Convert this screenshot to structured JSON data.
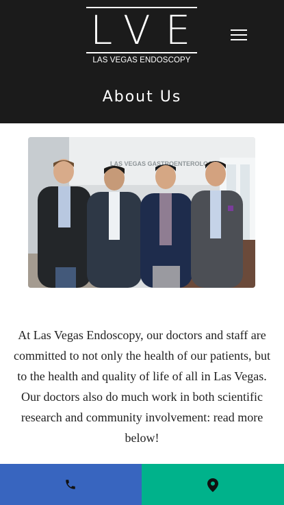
{
  "header": {
    "logo_letters": "LVE",
    "logo_subtitle": "LAS VEGAS ENDOSCOPY",
    "menu_icon": "hamburger-menu-icon",
    "background_color": "#1b1b1b"
  },
  "page": {
    "title": "About Us"
  },
  "content": {
    "photo_sign_text": "LAS VEGAS GASTROENTEROLOGY",
    "intro_text": "At Las Vegas Endoscopy, our doctors and staff are committed to not only the health of our patients, but to the health and quality of life of all in Las Vegas. Our doctors also do much work in both scientific research and community involvement: read more below!"
  },
  "action_bar": {
    "call": {
      "icon": "phone-icon",
      "color": "#3865bf"
    },
    "location": {
      "icon": "map-pin-icon",
      "color": "#00b28b"
    }
  }
}
